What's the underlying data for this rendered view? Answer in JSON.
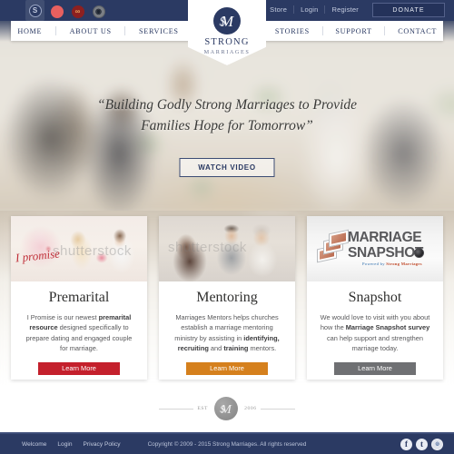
{
  "topbar": {
    "browser_tabs": [
      {
        "name": "tab-icon-strong-marriages",
        "glyph": "S",
        "color": "#2b3a63"
      },
      {
        "name": "tab-icon-red",
        "glyph": "",
        "color": "#e8605f"
      },
      {
        "name": "tab-icon-rings",
        "glyph": "∞",
        "color": "#8d2020"
      },
      {
        "name": "tab-icon-gray",
        "glyph": "◉",
        "color": "#7b7f85"
      }
    ],
    "links": [
      {
        "label": "Store"
      },
      {
        "label": "Login"
      },
      {
        "label": "Register"
      }
    ],
    "donate_label": "DONATE"
  },
  "nav": {
    "left_items": [
      {
        "label": "HOME"
      },
      {
        "label": "ABOUT US"
      },
      {
        "label": "SERVICES"
      }
    ],
    "right_items": [
      {
        "label": "STORIES"
      },
      {
        "label": "SUPPORT"
      },
      {
        "label": "CONTACT"
      }
    ]
  },
  "logo": {
    "monogram": "SM",
    "name": "STRONG",
    "subtitle": "MARRIAGES"
  },
  "hero": {
    "quote_line1": "“Building Godly Strong Marriages to Provide",
    "quote_line2": "Families Hope for Tomorrow”",
    "watch_video_label": "WATCH VIDEO"
  },
  "cards": [
    {
      "key": "premarital",
      "title": "Premarital",
      "image_overlay_text": "I promise",
      "image_watermark": "shutterstock",
      "text_parts": [
        {
          "t": "I Promise is our newest ",
          "b": false
        },
        {
          "t": "premarital resource",
          "b": true
        },
        {
          "t": " designed specifically to prepare dating and engaged couple for marriage.",
          "b": false
        }
      ],
      "button_label": "Learn More",
      "button_color": "#c4202c"
    },
    {
      "key": "mentoring",
      "title": "Mentoring",
      "image_watermark": "shutterstock",
      "text_parts": [
        {
          "t": "Marriages Mentors helps churches establish a marriage mentoring ministry by assisting in ",
          "b": false
        },
        {
          "t": "identifying, recruiting",
          "b": true
        },
        {
          "t": " and ",
          "b": false
        },
        {
          "t": "training",
          "b": true
        },
        {
          "t": " mentors.",
          "b": false
        }
      ],
      "button_label": "Learn More",
      "button_color": "#d5801d"
    },
    {
      "key": "snapshot",
      "title": "Snapshot",
      "logo_line1": "MARRIAGE",
      "logo_line2": "SNAPSHOT",
      "logo_tagline_pre": "Powered by ",
      "logo_tagline_brand": "Strong Marriages",
      "text_parts": [
        {
          "t": "We would love to visit with you about how the ",
          "b": false
        },
        {
          "t": "Marriage Snapshot survey",
          "b": true
        },
        {
          "t": " can help support and strengthen marriage today.",
          "b": false
        }
      ],
      "button_label": "Learn More",
      "button_color": "#6f7073"
    }
  ],
  "seal": {
    "est_label": "EST",
    "year": "2006",
    "monogram": "SM"
  },
  "footer": {
    "links": [
      {
        "label": "Welcome"
      },
      {
        "label": "Login"
      },
      {
        "label": "Privacy Policy"
      }
    ],
    "copyright": "Copyright © 2009 - 2015 Strong Marriages. All rights reserved",
    "social": [
      {
        "name": "facebook-icon",
        "glyph": "f"
      },
      {
        "name": "twitter-icon",
        "glyph": "t"
      },
      {
        "name": "social-icon-3",
        "glyph": "◎"
      }
    ]
  },
  "colors": {
    "navy": "#2b3a63",
    "red": "#c4202c",
    "orange": "#d5801d",
    "gray": "#6f7073"
  }
}
